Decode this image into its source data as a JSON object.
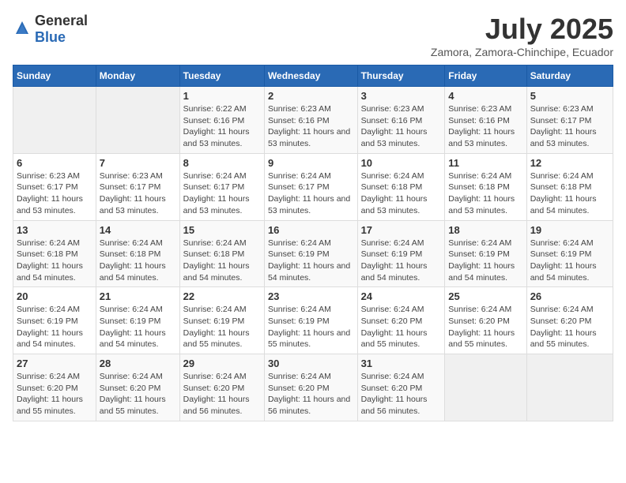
{
  "header": {
    "logo_general": "General",
    "logo_blue": "Blue",
    "month": "July 2025",
    "location": "Zamora, Zamora-Chinchipe, Ecuador"
  },
  "days_of_week": [
    "Sunday",
    "Monday",
    "Tuesday",
    "Wednesday",
    "Thursday",
    "Friday",
    "Saturday"
  ],
  "weeks": [
    [
      {
        "day": "",
        "sunrise": "",
        "sunset": "",
        "daylight": ""
      },
      {
        "day": "",
        "sunrise": "",
        "sunset": "",
        "daylight": ""
      },
      {
        "day": "1",
        "sunrise": "Sunrise: 6:22 AM",
        "sunset": "Sunset: 6:16 PM",
        "daylight": "Daylight: 11 hours and 53 minutes."
      },
      {
        "day": "2",
        "sunrise": "Sunrise: 6:23 AM",
        "sunset": "Sunset: 6:16 PM",
        "daylight": "Daylight: 11 hours and 53 minutes."
      },
      {
        "day": "3",
        "sunrise": "Sunrise: 6:23 AM",
        "sunset": "Sunset: 6:16 PM",
        "daylight": "Daylight: 11 hours and 53 minutes."
      },
      {
        "day": "4",
        "sunrise": "Sunrise: 6:23 AM",
        "sunset": "Sunset: 6:16 PM",
        "daylight": "Daylight: 11 hours and 53 minutes."
      },
      {
        "day": "5",
        "sunrise": "Sunrise: 6:23 AM",
        "sunset": "Sunset: 6:17 PM",
        "daylight": "Daylight: 11 hours and 53 minutes."
      }
    ],
    [
      {
        "day": "6",
        "sunrise": "Sunrise: 6:23 AM",
        "sunset": "Sunset: 6:17 PM",
        "daylight": "Daylight: 11 hours and 53 minutes."
      },
      {
        "day": "7",
        "sunrise": "Sunrise: 6:23 AM",
        "sunset": "Sunset: 6:17 PM",
        "daylight": "Daylight: 11 hours and 53 minutes."
      },
      {
        "day": "8",
        "sunrise": "Sunrise: 6:24 AM",
        "sunset": "Sunset: 6:17 PM",
        "daylight": "Daylight: 11 hours and 53 minutes."
      },
      {
        "day": "9",
        "sunrise": "Sunrise: 6:24 AM",
        "sunset": "Sunset: 6:17 PM",
        "daylight": "Daylight: 11 hours and 53 minutes."
      },
      {
        "day": "10",
        "sunrise": "Sunrise: 6:24 AM",
        "sunset": "Sunset: 6:18 PM",
        "daylight": "Daylight: 11 hours and 53 minutes."
      },
      {
        "day": "11",
        "sunrise": "Sunrise: 6:24 AM",
        "sunset": "Sunset: 6:18 PM",
        "daylight": "Daylight: 11 hours and 53 minutes."
      },
      {
        "day": "12",
        "sunrise": "Sunrise: 6:24 AM",
        "sunset": "Sunset: 6:18 PM",
        "daylight": "Daylight: 11 hours and 54 minutes."
      }
    ],
    [
      {
        "day": "13",
        "sunrise": "Sunrise: 6:24 AM",
        "sunset": "Sunset: 6:18 PM",
        "daylight": "Daylight: 11 hours and 54 minutes."
      },
      {
        "day": "14",
        "sunrise": "Sunrise: 6:24 AM",
        "sunset": "Sunset: 6:18 PM",
        "daylight": "Daylight: 11 hours and 54 minutes."
      },
      {
        "day": "15",
        "sunrise": "Sunrise: 6:24 AM",
        "sunset": "Sunset: 6:18 PM",
        "daylight": "Daylight: 11 hours and 54 minutes."
      },
      {
        "day": "16",
        "sunrise": "Sunrise: 6:24 AM",
        "sunset": "Sunset: 6:19 PM",
        "daylight": "Daylight: 11 hours and 54 minutes."
      },
      {
        "day": "17",
        "sunrise": "Sunrise: 6:24 AM",
        "sunset": "Sunset: 6:19 PM",
        "daylight": "Daylight: 11 hours and 54 minutes."
      },
      {
        "day": "18",
        "sunrise": "Sunrise: 6:24 AM",
        "sunset": "Sunset: 6:19 PM",
        "daylight": "Daylight: 11 hours and 54 minutes."
      },
      {
        "day": "19",
        "sunrise": "Sunrise: 6:24 AM",
        "sunset": "Sunset: 6:19 PM",
        "daylight": "Daylight: 11 hours and 54 minutes."
      }
    ],
    [
      {
        "day": "20",
        "sunrise": "Sunrise: 6:24 AM",
        "sunset": "Sunset: 6:19 PM",
        "daylight": "Daylight: 11 hours and 54 minutes."
      },
      {
        "day": "21",
        "sunrise": "Sunrise: 6:24 AM",
        "sunset": "Sunset: 6:19 PM",
        "daylight": "Daylight: 11 hours and 54 minutes."
      },
      {
        "day": "22",
        "sunrise": "Sunrise: 6:24 AM",
        "sunset": "Sunset: 6:19 PM",
        "daylight": "Daylight: 11 hours and 55 minutes."
      },
      {
        "day": "23",
        "sunrise": "Sunrise: 6:24 AM",
        "sunset": "Sunset: 6:19 PM",
        "daylight": "Daylight: 11 hours and 55 minutes."
      },
      {
        "day": "24",
        "sunrise": "Sunrise: 6:24 AM",
        "sunset": "Sunset: 6:20 PM",
        "daylight": "Daylight: 11 hours and 55 minutes."
      },
      {
        "day": "25",
        "sunrise": "Sunrise: 6:24 AM",
        "sunset": "Sunset: 6:20 PM",
        "daylight": "Daylight: 11 hours and 55 minutes."
      },
      {
        "day": "26",
        "sunrise": "Sunrise: 6:24 AM",
        "sunset": "Sunset: 6:20 PM",
        "daylight": "Daylight: 11 hours and 55 minutes."
      }
    ],
    [
      {
        "day": "27",
        "sunrise": "Sunrise: 6:24 AM",
        "sunset": "Sunset: 6:20 PM",
        "daylight": "Daylight: 11 hours and 55 minutes."
      },
      {
        "day": "28",
        "sunrise": "Sunrise: 6:24 AM",
        "sunset": "Sunset: 6:20 PM",
        "daylight": "Daylight: 11 hours and 55 minutes."
      },
      {
        "day": "29",
        "sunrise": "Sunrise: 6:24 AM",
        "sunset": "Sunset: 6:20 PM",
        "daylight": "Daylight: 11 hours and 56 minutes."
      },
      {
        "day": "30",
        "sunrise": "Sunrise: 6:24 AM",
        "sunset": "Sunset: 6:20 PM",
        "daylight": "Daylight: 11 hours and 56 minutes."
      },
      {
        "day": "31",
        "sunrise": "Sunrise: 6:24 AM",
        "sunset": "Sunset: 6:20 PM",
        "daylight": "Daylight: 11 hours and 56 minutes."
      },
      {
        "day": "",
        "sunrise": "",
        "sunset": "",
        "daylight": ""
      },
      {
        "day": "",
        "sunrise": "",
        "sunset": "",
        "daylight": ""
      }
    ]
  ]
}
